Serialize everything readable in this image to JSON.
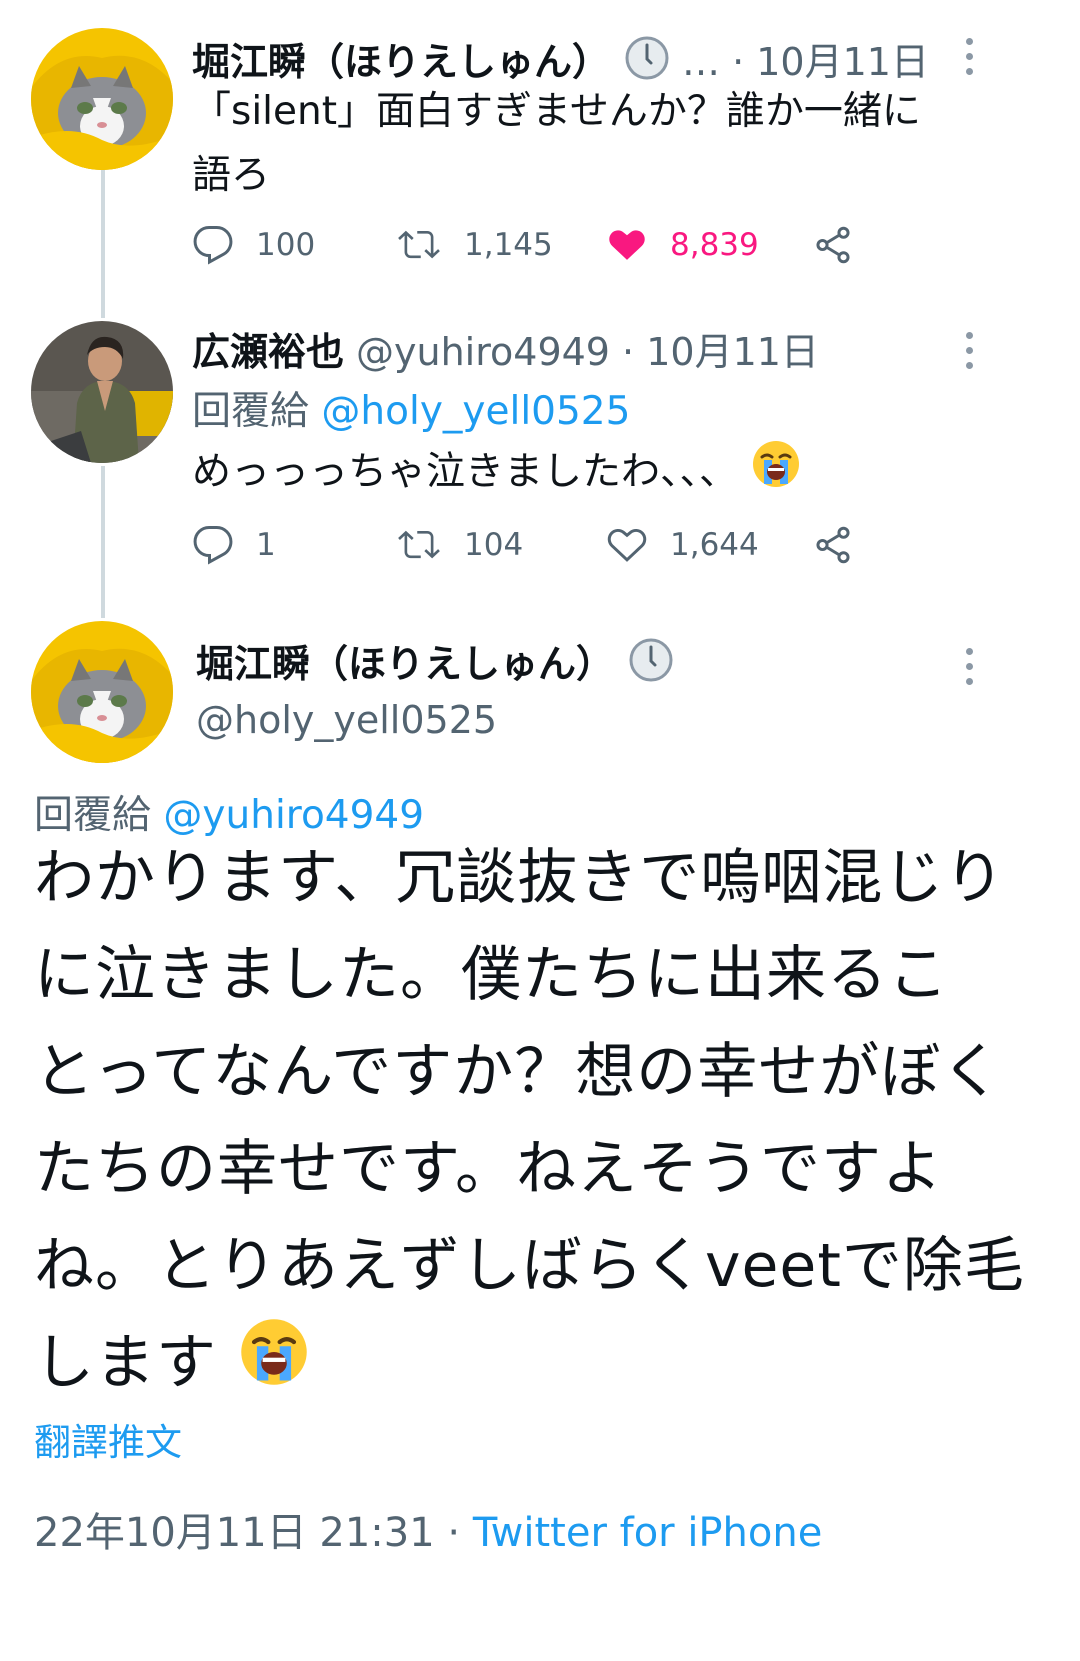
{
  "tweet1": {
    "display_name": "堀江瞬（ほりえしゅん）",
    "meta": "… · 10月11日",
    "text_line1": "「silent」面白すぎませんか？誰か一緒に",
    "text_line2": "語ろ",
    "replies": "100",
    "retweets": "1,145",
    "likes": "8,839",
    "liked": true
  },
  "tweet2": {
    "display_name": "広瀬裕也",
    "meta": "@yuhiro4949 · 10月11日",
    "reply_prefix": "回覆給",
    "reply_handle": "@holy_yell0525",
    "text": "めっっっちゃ泣きましたわ、、、",
    "replies": "1",
    "retweets": "104",
    "likes": "1,644"
  },
  "main_tweet": {
    "display_name": "堀江瞬（ほりえしゅん）",
    "handle": "@holy_yell0525",
    "reply_prefix": "回覆給",
    "reply_handle": "@yuhiro4949",
    "lines": [
      "わかります、冗談抜きで嗚咽混じり",
      "に泣きました。僕たちに出来るこ",
      "とってなんですか？想の幸せがぼく",
      "たちの幸せです。ねえそうですよ",
      "ね。とりあえずしばらくveetで除毛",
      "します"
    ],
    "translate_label": "翻譯推文",
    "timestamp": "22年10月11日 21:31 · ",
    "source": "Twitter for iPhone"
  },
  "colors": {
    "accent": "#1d9bf0",
    "like": "#f91880",
    "muted": "#536471",
    "avatar_cat_bg": "#f5c400"
  },
  "icons": [
    "clock-icon",
    "reply-icon",
    "retweet-icon",
    "heart-icon",
    "share-icon",
    "more-icon",
    "loudly-crying-emoji"
  ]
}
